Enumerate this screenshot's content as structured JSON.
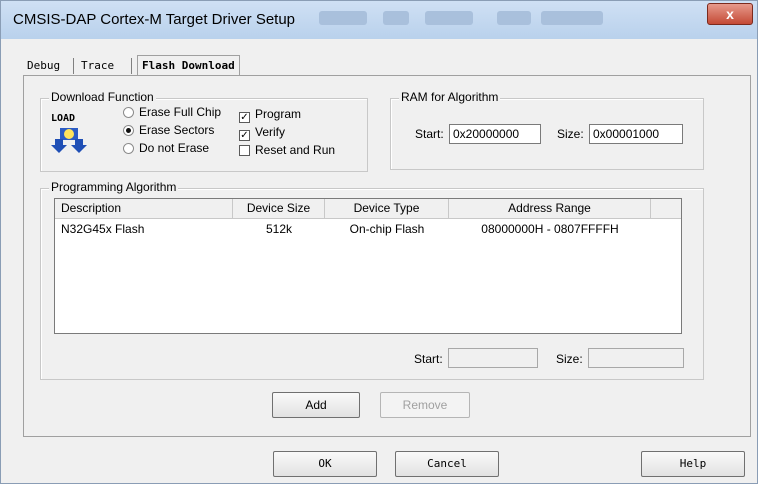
{
  "window": {
    "title": "CMSIS-DAP Cortex-M Target Driver Setup",
    "close_glyph": "x"
  },
  "tabs": [
    {
      "label": "Debug",
      "active": false
    },
    {
      "label": "Trace",
      "active": false
    },
    {
      "label": "Flash Download",
      "active": true
    }
  ],
  "download_function": {
    "title": "Download Function",
    "icon": "load-icon",
    "icon_text": "LOAD",
    "radios": [
      {
        "label": "Erase Full Chip",
        "checked": false
      },
      {
        "label": "Erase Sectors",
        "checked": true
      },
      {
        "label": "Do not Erase",
        "checked": false
      }
    ],
    "checks": [
      {
        "label": "Program",
        "checked": true
      },
      {
        "label": "Verify",
        "checked": true
      },
      {
        "label": "Reset and Run",
        "checked": false
      }
    ]
  },
  "ram": {
    "title": "RAM for Algorithm",
    "start_label": "Start:",
    "start_value": "0x20000000",
    "size_label": "Size:",
    "size_value": "0x00001000"
  },
  "programming": {
    "title": "Programming Algorithm",
    "columns": [
      "Description",
      "Device Size",
      "Device Type",
      "Address Range"
    ],
    "rows": [
      {
        "description": "N32G45x Flash",
        "size": "512k",
        "type": "On-chip Flash",
        "range": "08000000H - 0807FFFFH"
      }
    ],
    "start_label": "Start:",
    "start_value": "",
    "size_label": "Size:",
    "size_value": ""
  },
  "buttons": {
    "add": "Add",
    "remove": "Remove",
    "ok": "OK",
    "cancel": "Cancel",
    "help": "Help"
  },
  "colors": {
    "titlebar": "#b9d1ec",
    "close": "#c44a36",
    "face": "#f0f0f0"
  }
}
